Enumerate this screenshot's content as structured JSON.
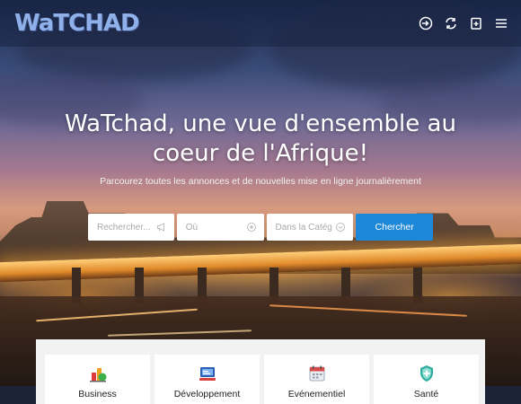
{
  "header": {
    "logo_text": "WaTCHAD",
    "icons": [
      "sign-in-icon",
      "refresh-icon",
      "add-listing-icon",
      "menu-icon"
    ]
  },
  "hero": {
    "title_line1": "WaTchad, une vue d'ensemble au",
    "title_line2": "coeur de l'Afrique!",
    "subtitle": "Parcourez toutes les annonces et de nouvelles mise en ligne journalièrement"
  },
  "search": {
    "keyword_placeholder": "Rechercher...",
    "location_placeholder": "Où",
    "category_placeholder": "Dans la Catég",
    "button_label": "Chercher"
  },
  "categories": [
    {
      "label": "Business",
      "icon": "business-icon"
    },
    {
      "label": "Développement",
      "icon": "development-icon"
    },
    {
      "label": "Evénementiel",
      "icon": "calendar-icon"
    },
    {
      "label": "Santé",
      "icon": "health-shield-icon"
    }
  ],
  "colors": {
    "accent": "#1e88d8",
    "logo": "#8fb0e8"
  }
}
